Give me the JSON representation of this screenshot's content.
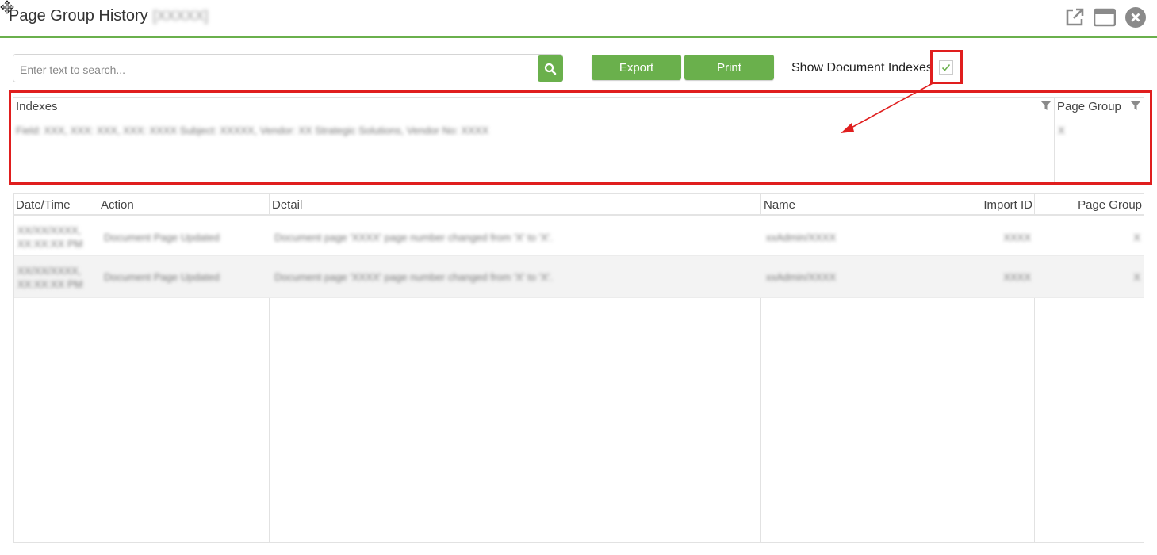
{
  "window": {
    "title": "Page Group History",
    "title_id": "[XXXXX]",
    "icons": [
      "move-cursor-icon",
      "popout-icon",
      "maximize-icon",
      "close-icon"
    ]
  },
  "toolbar": {
    "search_placeholder": "Enter text to search...",
    "search_value": "",
    "export_label": "Export",
    "print_label": "Print",
    "show_indexes_label": "Show Document Indexes",
    "show_indexes_checked": true
  },
  "indexes_table": {
    "columns": [
      "Indexes",
      "Page Group"
    ],
    "rows": [
      {
        "indexes": "Field: XXX, XXX: XXX, XXX: XXXX Subject: XXXXX, Vendor: XX Strategic Solutions, Vendor No: XXXX",
        "page_group": "X"
      }
    ]
  },
  "history_table": {
    "columns": [
      "Date/Time",
      "Action",
      "Detail",
      "Name",
      "Import ID",
      "Page Group"
    ],
    "rows": [
      {
        "datetime_line1": "XX/XX/XXXX,",
        "datetime_line2": "XX:XX:XX PM",
        "action": "Document Page Updated",
        "detail": "Document page 'XXXX' page number changed from 'X' to 'X'.",
        "name": "xxAdmin/XXXX",
        "import_id": "XXXX",
        "page_group": "X"
      },
      {
        "datetime_line1": "XX/XX/XXXX,",
        "datetime_line2": "XX:XX:XX PM",
        "action": "Document Page Updated",
        "detail": "Document page 'XXXX' page number changed from 'X' to 'X'.",
        "name": "xxAdmin/XXXX",
        "import_id": "XXXX",
        "page_group": "X"
      }
    ]
  },
  "colors": {
    "accent": "#6ab04c",
    "annotation": "#e01e1e"
  }
}
